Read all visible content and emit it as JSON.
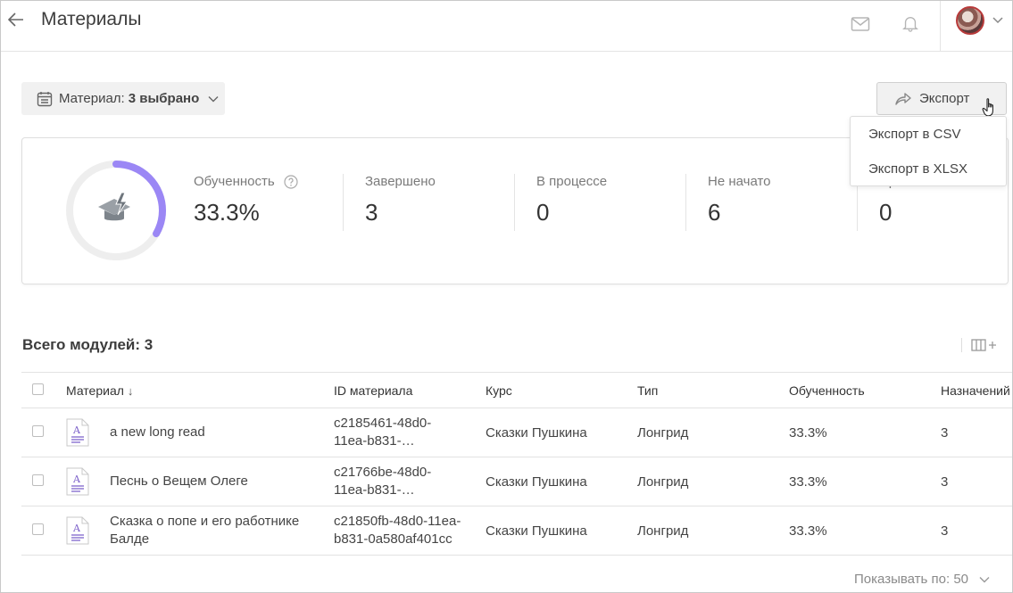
{
  "header": {
    "title": "Материалы"
  },
  "filter": {
    "label": "Материал:",
    "value": "3 выбрано"
  },
  "export": {
    "label": "Экспорт",
    "menu": [
      "Экспорт в CSV",
      "Экспорт в XLSX"
    ]
  },
  "stats": {
    "progress_fraction": 0.333,
    "items": [
      {
        "label": "Обученность",
        "value": "33.3%"
      },
      {
        "label": "Завершено",
        "value": "3"
      },
      {
        "label": "В процессе",
        "value": "0"
      },
      {
        "label": "Не начато",
        "value": "6"
      },
      {
        "label": "Пр",
        "value": "0"
      }
    ]
  },
  "modules": {
    "title": "Всего модулей: 3"
  },
  "table": {
    "columns": [
      "Материал",
      "ID материала",
      "Курс",
      "Тип",
      "Обученность",
      "Назначений"
    ],
    "rows": [
      {
        "name": "a new long read",
        "id_line1": "c2185461-48d0-",
        "id_line2": "11ea-b831-…",
        "course": "Сказки Пушкина",
        "type": "Лонгрид",
        "progress": "33.3%",
        "assigned": "3"
      },
      {
        "name": "Песнь о Вещем Олеге",
        "id_line1": "c21766be-48d0-",
        "id_line2": "11ea-b831-…",
        "course": "Сказки Пушкина",
        "type": "Лонгрид",
        "progress": "33.3%",
        "assigned": "3"
      },
      {
        "name": "Сказка о попе и его работнике Балде",
        "id_line1": "c21850fb-48d0-11ea-",
        "id_line2": "b831-0a580af401cc",
        "course": "Сказки Пушкина",
        "type": "Лонгрид",
        "progress": "33.3%",
        "assigned": "3"
      }
    ]
  },
  "pagination": {
    "label": "Показывать по: 50"
  },
  "colors": {
    "accent": "#9b87f5",
    "ring_track": "#eeeeee",
    "doc_accent": "#7b5fc9"
  }
}
